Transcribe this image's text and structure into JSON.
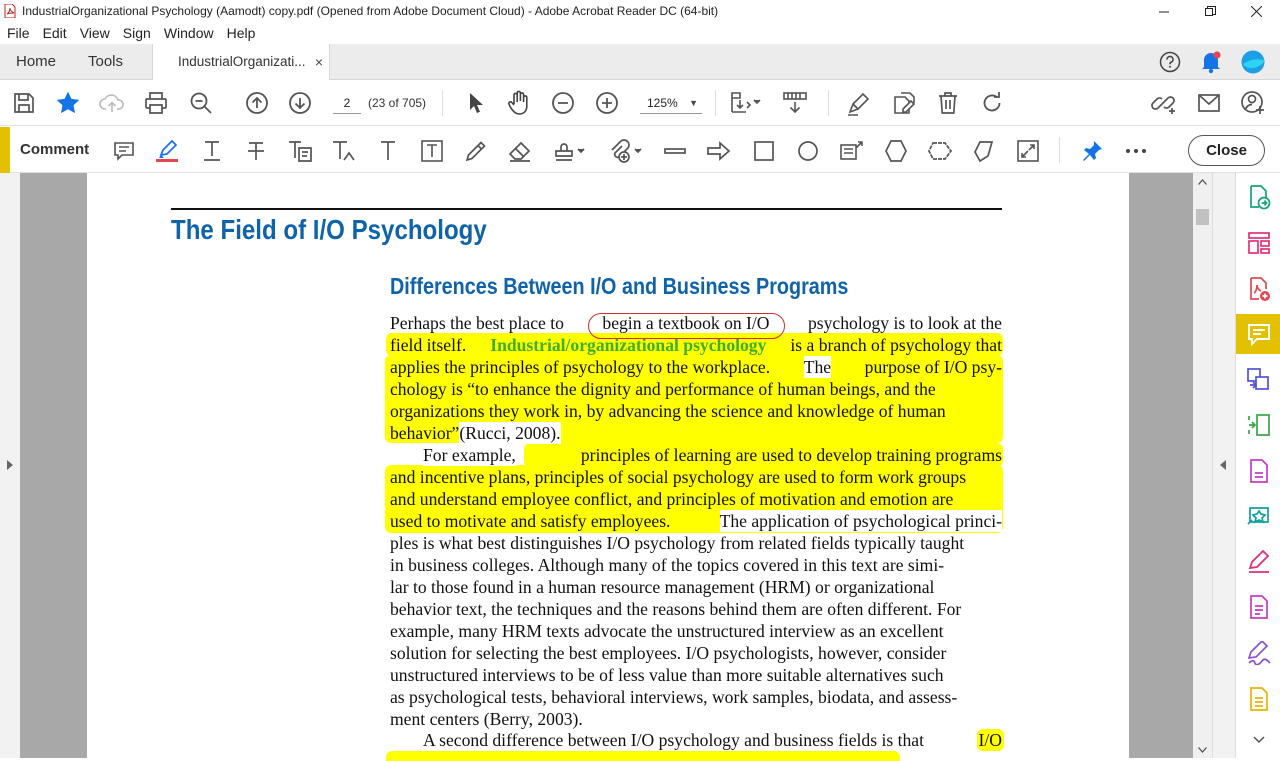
{
  "window": {
    "title": "IndustrialOrganizational Psychology (Aamodt) copy.pdf (Opened from Adobe Document Cloud) - Adobe Acrobat Reader DC (64-bit)"
  },
  "menu": [
    "File",
    "Edit",
    "View",
    "Sign",
    "Window",
    "Help"
  ],
  "tabs": {
    "home": "Home",
    "tools": "Tools",
    "document": "IndustrialOrganizati...",
    "close_glyph": "×"
  },
  "toolbar": {
    "page_number": "2",
    "page_count": "(23 of 705)",
    "zoom": "125%"
  },
  "comment_bar": {
    "label": "Comment",
    "close": "Close"
  },
  "document": {
    "chapter_title": "The Field of I/O Psychology",
    "section_title": "Differences Between I/O and Business Programs",
    "lines": [
      [
        "Perhaps the best place to ",
        "begin a textbook on I/O ",
        "psychology is to look at the"
      ],
      [
        "field itself. ",
        "Industrial/organizational psychology",
        " is a branch of psychology that"
      ],
      [
        "applies the principles of psychology to the workplace.",
        " The ",
        "purpose of I/O psy-"
      ],
      [
        "chology is “to enhance the dignity and performance of human beings, and the"
      ],
      [
        "organizations they work in, by advancing the science and knowledge of human"
      ],
      [
        "behavior”",
        " (Rucci, 2008)."
      ],
      [
        "For example, ",
        "principles of learning are used to develop training programs"
      ],
      [
        "and incentive plans, principles of social psychology are used to form work groups"
      ],
      [
        "and understand employee conflict, and principles of motivation and emotion are"
      ],
      [
        "used to motivate and satisfy employees.",
        " The application of psychological princi-"
      ],
      [
        "ples is what best distinguishes I/O psychology from related fields typically taught"
      ],
      [
        "in business colleges. Although many of the topics covered in this text are simi-"
      ],
      [
        "lar to those found in a human resource management (HRM) or organizational"
      ],
      [
        "behavior text, the techniques and the reasons behind them are often different. For"
      ],
      [
        "example, many HRM texts advocate the unstructured interview as an excellent"
      ],
      [
        "solution for selecting the best employees. I/O psychologists, however, consider"
      ],
      [
        "unstructured interviews to be of less value than more suitable alternatives such"
      ],
      [
        "as psychological tests, behavioral interviews, work samples, biodata, and assess-"
      ],
      [
        "ment centers (Berry, 2003)."
      ],
      [
        "A second difference between I/O psychology and business fields is that ",
        "I/O"
      ]
    ]
  },
  "colors": {
    "heading_blue": "#0f63aa",
    "highlight": "#ffff00",
    "comment_accent": "#e4c100",
    "circle_annotation": "#d92c2c",
    "key_term_green": "#3fae2a"
  },
  "icons": {
    "title_bar": [
      "pdf-app-icon",
      "minimize-icon",
      "restore-icon",
      "close-window-icon"
    ],
    "tab_bar": [
      "help-icon",
      "notification-bell-icon",
      "account-avatar-icon"
    ],
    "toolbar": [
      "save-icon",
      "bookmark-star-icon",
      "cloud-upload-icon",
      "print-icon",
      "search-zoom-icon",
      "page-up-icon",
      "page-down-icon",
      "select-cursor-icon",
      "hand-tool-icon",
      "zoom-out-icon",
      "zoom-in-icon",
      "page-fit-icon",
      "scroll-mode-icon",
      "fill-sign-icon",
      "edit-pdf-icon",
      "delete-icon",
      "rotate-icon",
      "share-link-icon",
      "email-icon",
      "add-user-icon"
    ],
    "comment_bar": [
      "sticky-note-icon",
      "highlight-text-icon",
      "underline-text-icon",
      "strikethrough-text-icon",
      "replace-text-icon",
      "insert-text-icon",
      "add-text-comment-icon",
      "text-box-icon",
      "pencil-draw-icon",
      "eraser-icon",
      "stamp-icon",
      "attach-file-icon",
      "line-icon",
      "arrow-icon",
      "rectangle-icon",
      "oval-icon",
      "text-callout-icon",
      "polygon-icon",
      "cloud-shape-icon",
      "polygon-line-icon",
      "group-annotations-icon",
      "pin-icon",
      "more-options-icon"
    ],
    "right_panel": [
      "export-pdf-icon",
      "organize-pages-icon",
      "create-pdf-icon",
      "comment-icon",
      "combine-files-icon",
      "compress-pdf-icon",
      "edit-pdf-icon",
      "send-for-comments-icon",
      "fill-sign-icon",
      "protect-pdf-icon",
      "sign-icon",
      "more-tools-icon"
    ]
  }
}
